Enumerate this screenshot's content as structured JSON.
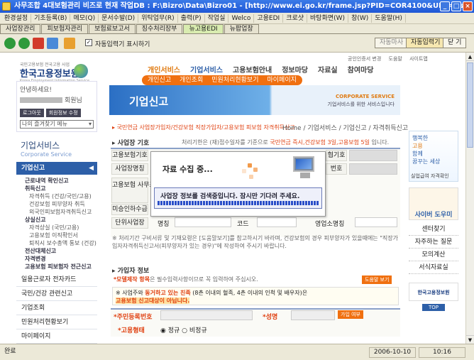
{
  "window": {
    "title": "사무조합 4대보험관리 비즈로   현재 작업DB : F:\\Bizro\\Data\\Bizro01 - [http://www.ei.go.kr/frame.jsp?PID=COR4100&URL=/js..."
  },
  "menu": [
    "환경설정",
    "기초등록(B)",
    "메모(Q)",
    "문서수발(D)",
    "위탁업무(R)",
    "출력(P)",
    "작업실",
    "Welco",
    "고용EDI",
    "크로샷",
    "바탕화면(W)",
    "창(W)",
    "도움말(H)"
  ],
  "app_tabs": [
    "사업장관리",
    "피보험자관리",
    "보험료보고서",
    "징수처리장부",
    "뉴고용EDI",
    "뉴팝업창"
  ],
  "toolbar": {
    "checkbox_label": "자동입력기 표시하기",
    "btn_auto_off": "자동마사",
    "btn_auto_input": "자동입력기",
    "btn_close": "닫 기"
  },
  "site": {
    "top_links": [
      "공인인증서 변경",
      "도움말",
      "사이트맵",
      "사이트맵"
    ],
    "logo_small": "국민고용보험 전국고용 사업",
    "logo": "한국고용정보원",
    "logo_sub": "Korea Employment Information Service",
    "nav": [
      "개인서비스",
      "기업서비스",
      "고용보험안내",
      "정보마당",
      "자료실",
      "참여마당"
    ],
    "subnav": [
      "개인신고",
      "개인조회",
      "민원처리현황보기",
      "마이페이지"
    ],
    "banner_title": "기업신고",
    "banner_sub": "CORPORATE SERVICE",
    "banner_desc": "기업서비스를 위한 서비스입니다",
    "notice": "국민연금 사업장가입자/건강보험 직장가입자/고용보험 피보험 자격취득신고",
    "breadcrumb": "Home / 기업서비스 / 기업신고 / 자격취득신고"
  },
  "sidebar": {
    "greeting": "안녕하세요!",
    "member_suffix": "회원님",
    "btn_logout": "로그아웃",
    "btn_edit": "회원정보 수정",
    "fav_select": "나의 즐겨찾기 메뉴",
    "section_title": "기업서비스",
    "section_sub": "Corporate Service",
    "active_item": "기업신고",
    "subitems": [
      {
        "text": "근로내역 확인신고",
        "style": "bold"
      },
      {
        "text": "취득신고",
        "style": "bold"
      },
      {
        "text": "자격취득 (건강/국민/고용)",
        "style": "indent"
      },
      {
        "text": "건강보험 피부양자 취득",
        "style": "indent"
      },
      {
        "text": "외국인피보험자격취득신고",
        "style": "indent"
      },
      {
        "text": "상실신고",
        "style": "bold"
      },
      {
        "text": "자격상실 (국민/고용)",
        "style": "indent"
      },
      {
        "text": "고용보험 이직확인서",
        "style": "indent"
      },
      {
        "text": "퇴직시 보수총액 통보 (건강)",
        "style": "indent"
      },
      {
        "text": "전산대체신고",
        "style": "bold"
      },
      {
        "text": "자격변경",
        "style": "bold"
      },
      {
        "text": "고용보험 피보험자 전근신고",
        "style": "bold"
      }
    ],
    "menu": [
      "일용근로자 전자카드",
      "국민/건강 관련신고",
      "기업조회",
      "민원처리현황보기",
      "마이페이지"
    ]
  },
  "form": {
    "section1_title": "사업장 기호",
    "section1_desc": "처리기한은 (재)접수일자를 기준으로",
    "section1_highlight": "국민연금 즉시,건강보험 3일,고용보험 5일",
    "section1_tail": "입니다.",
    "labels": [
      "고용보험기호",
      "사업장명칭",
      "고용보험\n사무조합",
      "미승인하수급",
      "단위사업장"
    ],
    "right_labels": [
      "협기호",
      "번호"
    ],
    "row5_items": [
      "명칭",
      "코드",
      "영업소명칭"
    ],
    "help_note": "처리기간 구비서류 및 기재요령은 [도움말보기]를 참고하시기 바라며, 건강보험의 경우 피부양자가 있을때에는 \"직장가입자자격취득신고서(피부양자가 있는 경우)\"에 작성하여 주시기 바랍니다.",
    "section2_title": "가입자 정보",
    "section2_desc_red": "*모델제작 항목",
    "section2_desc": "은 필수입력사항이므로 꼭 입력하여 주십시오.",
    "help_btn": "도움말 보기",
    "notice2_a": "사업주와",
    "notice2_red": "동거하고 있는 친족",
    "notice2_b": "(8촌 이내의 혈족, 4촌 이내의 인척 및 배우자)은",
    "notice2_c": "고용보험 신고대상이 아닙니다.",
    "id_label": "*주민등록번호",
    "name_label": "*성명",
    "join_btn": "가입 여부",
    "employ_label": "*고용형태",
    "radio_regular": "정규",
    "radio_irregular": "비정규"
  },
  "modal": {
    "title": "자료 수집 중...",
    "message": "사업장 정보를 검색중입니다.  잠시만 기다려 주세요."
  },
  "rightcol": {
    "promo": [
      "행복한",
      "고용",
      "함께",
      "꿈꾸는 세상"
    ],
    "promo_sub": "실업급여 자격확인",
    "cyber_title": "사이버 도우미",
    "links": [
      "센터찾기",
      "자주하는 질문",
      "모의계산",
      "서식자료실"
    ],
    "logo": "한국고용정보원",
    "top": "TOP"
  },
  "status": {
    "text": "완료",
    "date": "2006-10-10",
    "time": "10:16"
  },
  "colors": {
    "accent_orange": "#f07010",
    "nav_blue": "#2d5fa8",
    "active_green": "#d9ecb0",
    "title_blue": "#2458d0"
  }
}
